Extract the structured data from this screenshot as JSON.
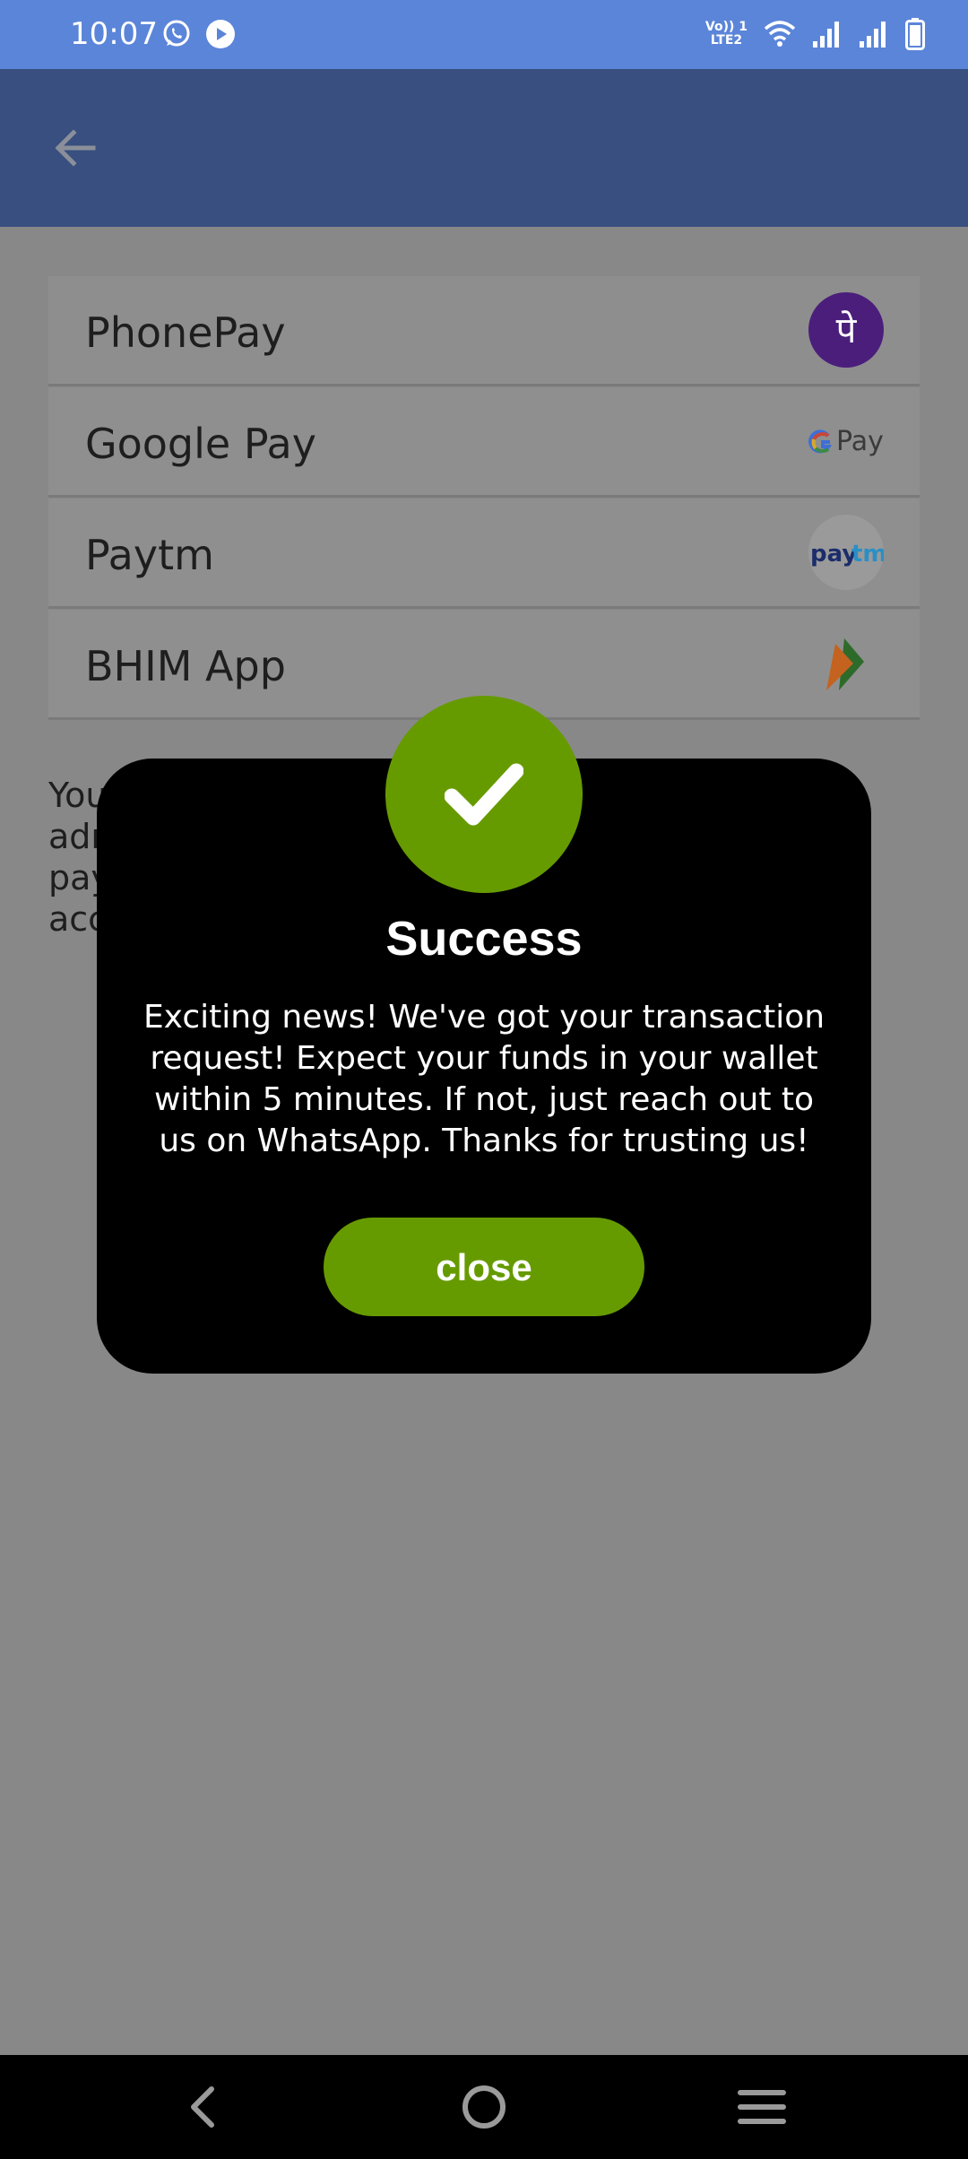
{
  "status_bar": {
    "time": "10:07",
    "left_icons": [
      "whatsapp-icon",
      "play-icon"
    ],
    "volte_label_line1": "Vo)) 1",
    "volte_label_line2": "LTE2",
    "right_icons": [
      "wifi-icon",
      "signal-icon",
      "signal-icon",
      "battery-icon"
    ]
  },
  "app_bar": {
    "back_icon": "arrow-left-icon"
  },
  "payment_options": [
    {
      "label": "PhonePay",
      "icon": "phonepe-logo"
    },
    {
      "label": "Google Pay",
      "icon": "google-pay-logo"
    },
    {
      "label": "Paytm",
      "icon": "paytm-logo"
    },
    {
      "label": "BHIM App",
      "icon": "bhim-logo"
    }
  ],
  "logos": {
    "phonepe_glyph": "पे",
    "gpay_text": "Pay",
    "paytm_text_1": "pay",
    "paytm_text_2": "tm"
  },
  "background_text": "You\nadr\npay\nacc",
  "dialog": {
    "icon": "checkmark-icon",
    "title": "Success",
    "message": "Exciting news! We've got your transaction request! Expect your funds in your wallet within 5 minutes. If not, just reach out to us on WhatsApp. Thanks for trusting us!",
    "close_label": "close"
  },
  "nav_bar": {
    "icons": [
      "back-nav-icon",
      "home-nav-icon",
      "menu-nav-icon"
    ]
  },
  "colors": {
    "status_bar": "#5b85d9",
    "app_bar": "#384f7f",
    "accent_green": "#669b00",
    "dialog_bg": "#000000",
    "scrim_bg": "#888888"
  }
}
